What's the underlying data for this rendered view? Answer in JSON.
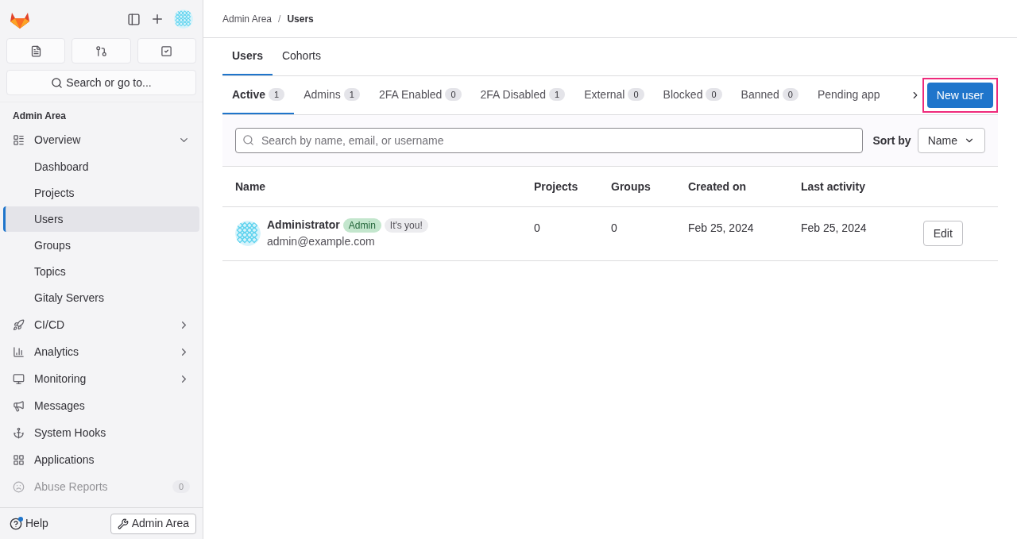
{
  "sidebar": {
    "search": "Search or go to...",
    "section_title": "Admin Area",
    "items": [
      {
        "label": "Overview",
        "expanded": true,
        "faded": false,
        "children": [
          {
            "label": "Dashboard",
            "selected": false
          },
          {
            "label": "Projects",
            "selected": false
          },
          {
            "label": "Users",
            "selected": true
          },
          {
            "label": "Groups",
            "selected": false
          },
          {
            "label": "Topics",
            "selected": false
          },
          {
            "label": "Gitaly Servers",
            "selected": false
          }
        ]
      },
      {
        "label": "CI/CD",
        "expanded": false,
        "faded": false
      },
      {
        "label": "Analytics",
        "expanded": false,
        "faded": false
      },
      {
        "label": "Monitoring",
        "expanded": false,
        "faded": false
      },
      {
        "label": "Messages",
        "faded": false
      },
      {
        "label": "System Hooks",
        "faded": false
      },
      {
        "label": "Applications",
        "faded": false
      },
      {
        "label": "Abuse Reports",
        "faded": true,
        "count": "0"
      }
    ],
    "help": "Help",
    "help_notification": true,
    "admin_button": "Admin Area"
  },
  "breadcrumb_separator": "/",
  "breadcrumbs": [
    {
      "label": "Admin Area",
      "current": false
    },
    {
      "label": "Users",
      "current": true
    }
  ],
  "top_tabs": [
    {
      "label": "Users",
      "selected": true
    },
    {
      "label": "Cohorts",
      "selected": false
    }
  ],
  "filter_tabs": [
    {
      "label": "Active",
      "count": "1",
      "selected": true
    },
    {
      "label": "Admins",
      "count": "1",
      "selected": false
    },
    {
      "label": "2FA Enabled",
      "count": "0",
      "selected": false
    },
    {
      "label": "2FA Disabled",
      "count": "1",
      "selected": false
    },
    {
      "label": "External",
      "count": "0",
      "selected": false
    },
    {
      "label": "Blocked",
      "count": "0",
      "selected": false
    },
    {
      "label": "Banned",
      "count": "0",
      "selected": false
    },
    {
      "label": "Pending app",
      "selected": false
    }
  ],
  "new_user_button": {
    "label": "New user",
    "highlighted": true
  },
  "search": {
    "placeholder": "Search by name, email, or username"
  },
  "sort": {
    "label": "Sort by",
    "value": "Name"
  },
  "table": {
    "columns": [
      "Name",
      "Projects",
      "Groups",
      "Created on",
      "Last activity"
    ],
    "rows": [
      {
        "name": "Administrator",
        "badges": [
          {
            "label": "Admin",
            "kind": "admin"
          },
          {
            "label": "It's you!",
            "kind": "neutral"
          }
        ],
        "email": "admin@example.com",
        "projects": "0",
        "groups": "0",
        "created_on": "Feb 25, 2024",
        "last_activity": "Feb 25, 2024",
        "action": "Edit"
      }
    ]
  }
}
